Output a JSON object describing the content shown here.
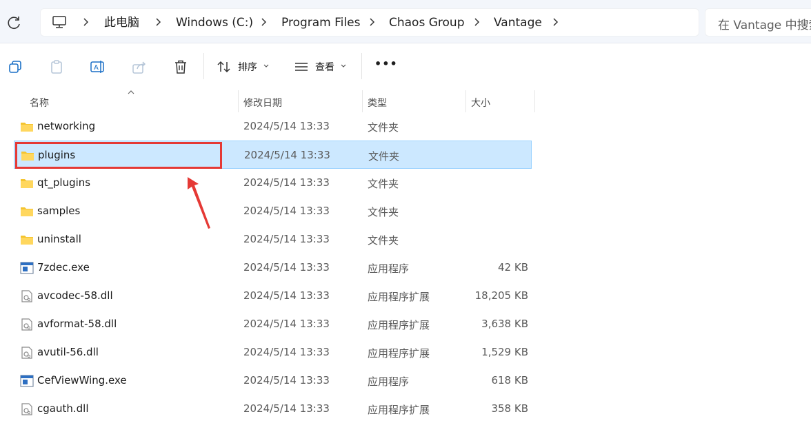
{
  "breadcrumb": [
    "此电脑",
    "Windows (C:)",
    "Program Files",
    "Chaos Group",
    "Vantage"
  ],
  "search": {
    "placeholder": "在 Vantage 中搜索"
  },
  "toolbar": {
    "sort_label": "排序",
    "view_label": "查看",
    "more_label": "•••"
  },
  "columns": {
    "name": "名称",
    "date": "修改日期",
    "type": "类型",
    "size": "大小"
  },
  "files": [
    {
      "name": "networking",
      "date": "2024/5/14 13:33",
      "type": "文件夹",
      "size": "",
      "icon": "folder-icon"
    },
    {
      "name": "plugins",
      "date": "2024/5/14 13:33",
      "type": "文件夹",
      "size": "",
      "icon": "folder-icon",
      "selected": true
    },
    {
      "name": "qt_plugins",
      "date": "2024/5/14 13:33",
      "type": "文件夹",
      "size": "",
      "icon": "folder-icon"
    },
    {
      "name": "samples",
      "date": "2024/5/14 13:33",
      "type": "文件夹",
      "size": "",
      "icon": "folder-icon"
    },
    {
      "name": "uninstall",
      "date": "2024/5/14 13:33",
      "type": "文件夹",
      "size": "",
      "icon": "folder-icon"
    },
    {
      "name": "7zdec.exe",
      "date": "2024/5/14 13:33",
      "type": "应用程序",
      "size": "42 KB",
      "icon": "exe-icon"
    },
    {
      "name": "avcodec-58.dll",
      "date": "2024/5/14 13:33",
      "type": "应用程序扩展",
      "size": "18,205 KB",
      "icon": "dll-icon"
    },
    {
      "name": "avformat-58.dll",
      "date": "2024/5/14 13:33",
      "type": "应用程序扩展",
      "size": "3,638 KB",
      "icon": "dll-icon"
    },
    {
      "name": "avutil-56.dll",
      "date": "2024/5/14 13:33",
      "type": "应用程序扩展",
      "size": "1,529 KB",
      "icon": "dll-icon"
    },
    {
      "name": "CefViewWing.exe",
      "date": "2024/5/14 13:33",
      "type": "应用程序",
      "size": "618 KB",
      "icon": "exe-icon"
    },
    {
      "name": "cgauth.dll",
      "date": "2024/5/14 13:33",
      "type": "应用程序扩展",
      "size": "358 KB",
      "icon": "dll-icon"
    }
  ],
  "colors": {
    "selection_bg": "#cce8ff",
    "selection_border": "#99d1ff",
    "annotation": "#e53935",
    "folder": "#f4c430"
  }
}
